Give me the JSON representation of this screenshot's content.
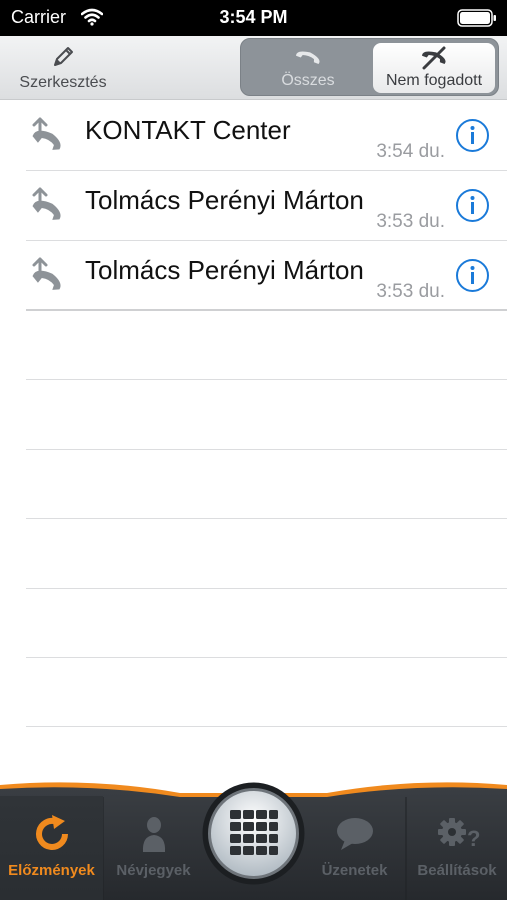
{
  "status_bar": {
    "carrier": "Carrier",
    "time": "3:54 PM",
    "wifi_icon": "wifi-icon",
    "battery_icon": "battery-icon"
  },
  "toolbar": {
    "edit_label": "Szerkesztés",
    "edit_icon": "pencil-icon",
    "segments": [
      {
        "label": "Összes",
        "icon": "phone-icon",
        "selected": false
      },
      {
        "label": "Nem fogadott",
        "icon": "missed-call-icon",
        "selected": true
      }
    ]
  },
  "calls": [
    {
      "name": "KONTAKT Center",
      "time": "3:54 du.",
      "icon": "outgoing-call-icon"
    },
    {
      "name": "Tolmács Perényi Márton",
      "time": "3:53 du.",
      "icon": "outgoing-call-icon"
    },
    {
      "name": "Tolmács Perényi Márton",
      "time": "3:53 du.",
      "icon": "outgoing-call-icon"
    }
  ],
  "tabbar": {
    "tabs": [
      {
        "label": "Előzmények",
        "icon": "history-refresh-icon",
        "active": true
      },
      {
        "label": "Névjegyek",
        "icon": "contact-person-icon",
        "active": false
      },
      {
        "label": "Üzenetek",
        "icon": "chat-bubble-icon",
        "active": false
      },
      {
        "label": "Beállítások",
        "icon": "settings-gears-icon",
        "active": false
      }
    ],
    "dialpad_icon": "dialpad-icon"
  },
  "colors": {
    "accent": "#f08a1e",
    "info_blue": "#1a7ad9",
    "tabbar_bg": "#2c3034",
    "segment_bg": "#8d9399"
  }
}
